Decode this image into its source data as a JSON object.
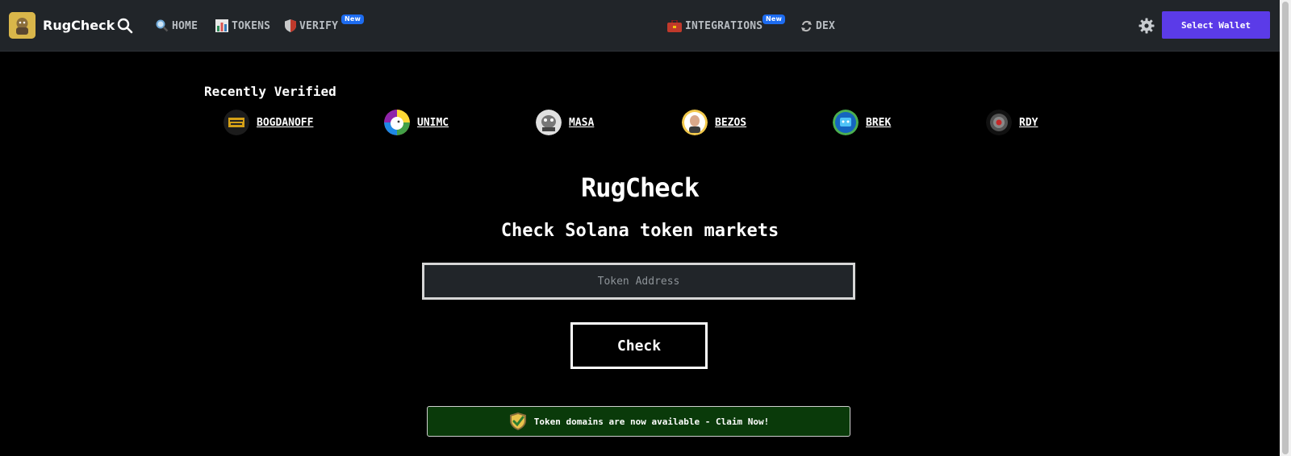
{
  "navbar": {
    "brand_name": "RugCheck",
    "links": [
      {
        "label": "HOME",
        "icon": "magnifier-icon"
      },
      {
        "label": "TOKENS",
        "icon": "bar-chart-icon"
      },
      {
        "label": "VERIFY",
        "icon": "shield-icon",
        "badge": "New"
      },
      {
        "label": "INTEGRATIONS",
        "icon": "toolbox-icon",
        "badge": "New"
      },
      {
        "label": "DEX",
        "icon": "swap-icon"
      }
    ],
    "wallet_button": "Select Wallet"
  },
  "recent": {
    "title": "Recently Verified",
    "tokens": [
      {
        "symbol": "BOGDANOFF"
      },
      {
        "symbol": "UNIMC"
      },
      {
        "symbol": "MASA"
      },
      {
        "symbol": "BEZOS"
      },
      {
        "symbol": "BREK"
      },
      {
        "symbol": "RDY"
      }
    ]
  },
  "hero": {
    "title": "RugCheck",
    "subtitle": "Check Solana token markets",
    "input_placeholder": "Token Address",
    "check_button": "Check"
  },
  "promo": {
    "text": "Token domains are now available - Claim Now!"
  },
  "colors": {
    "navbar_bg": "#212529",
    "wallet_button": "#5b3be8",
    "badge": "#1d6cf0",
    "promo_bg": "#0a3a0a"
  }
}
